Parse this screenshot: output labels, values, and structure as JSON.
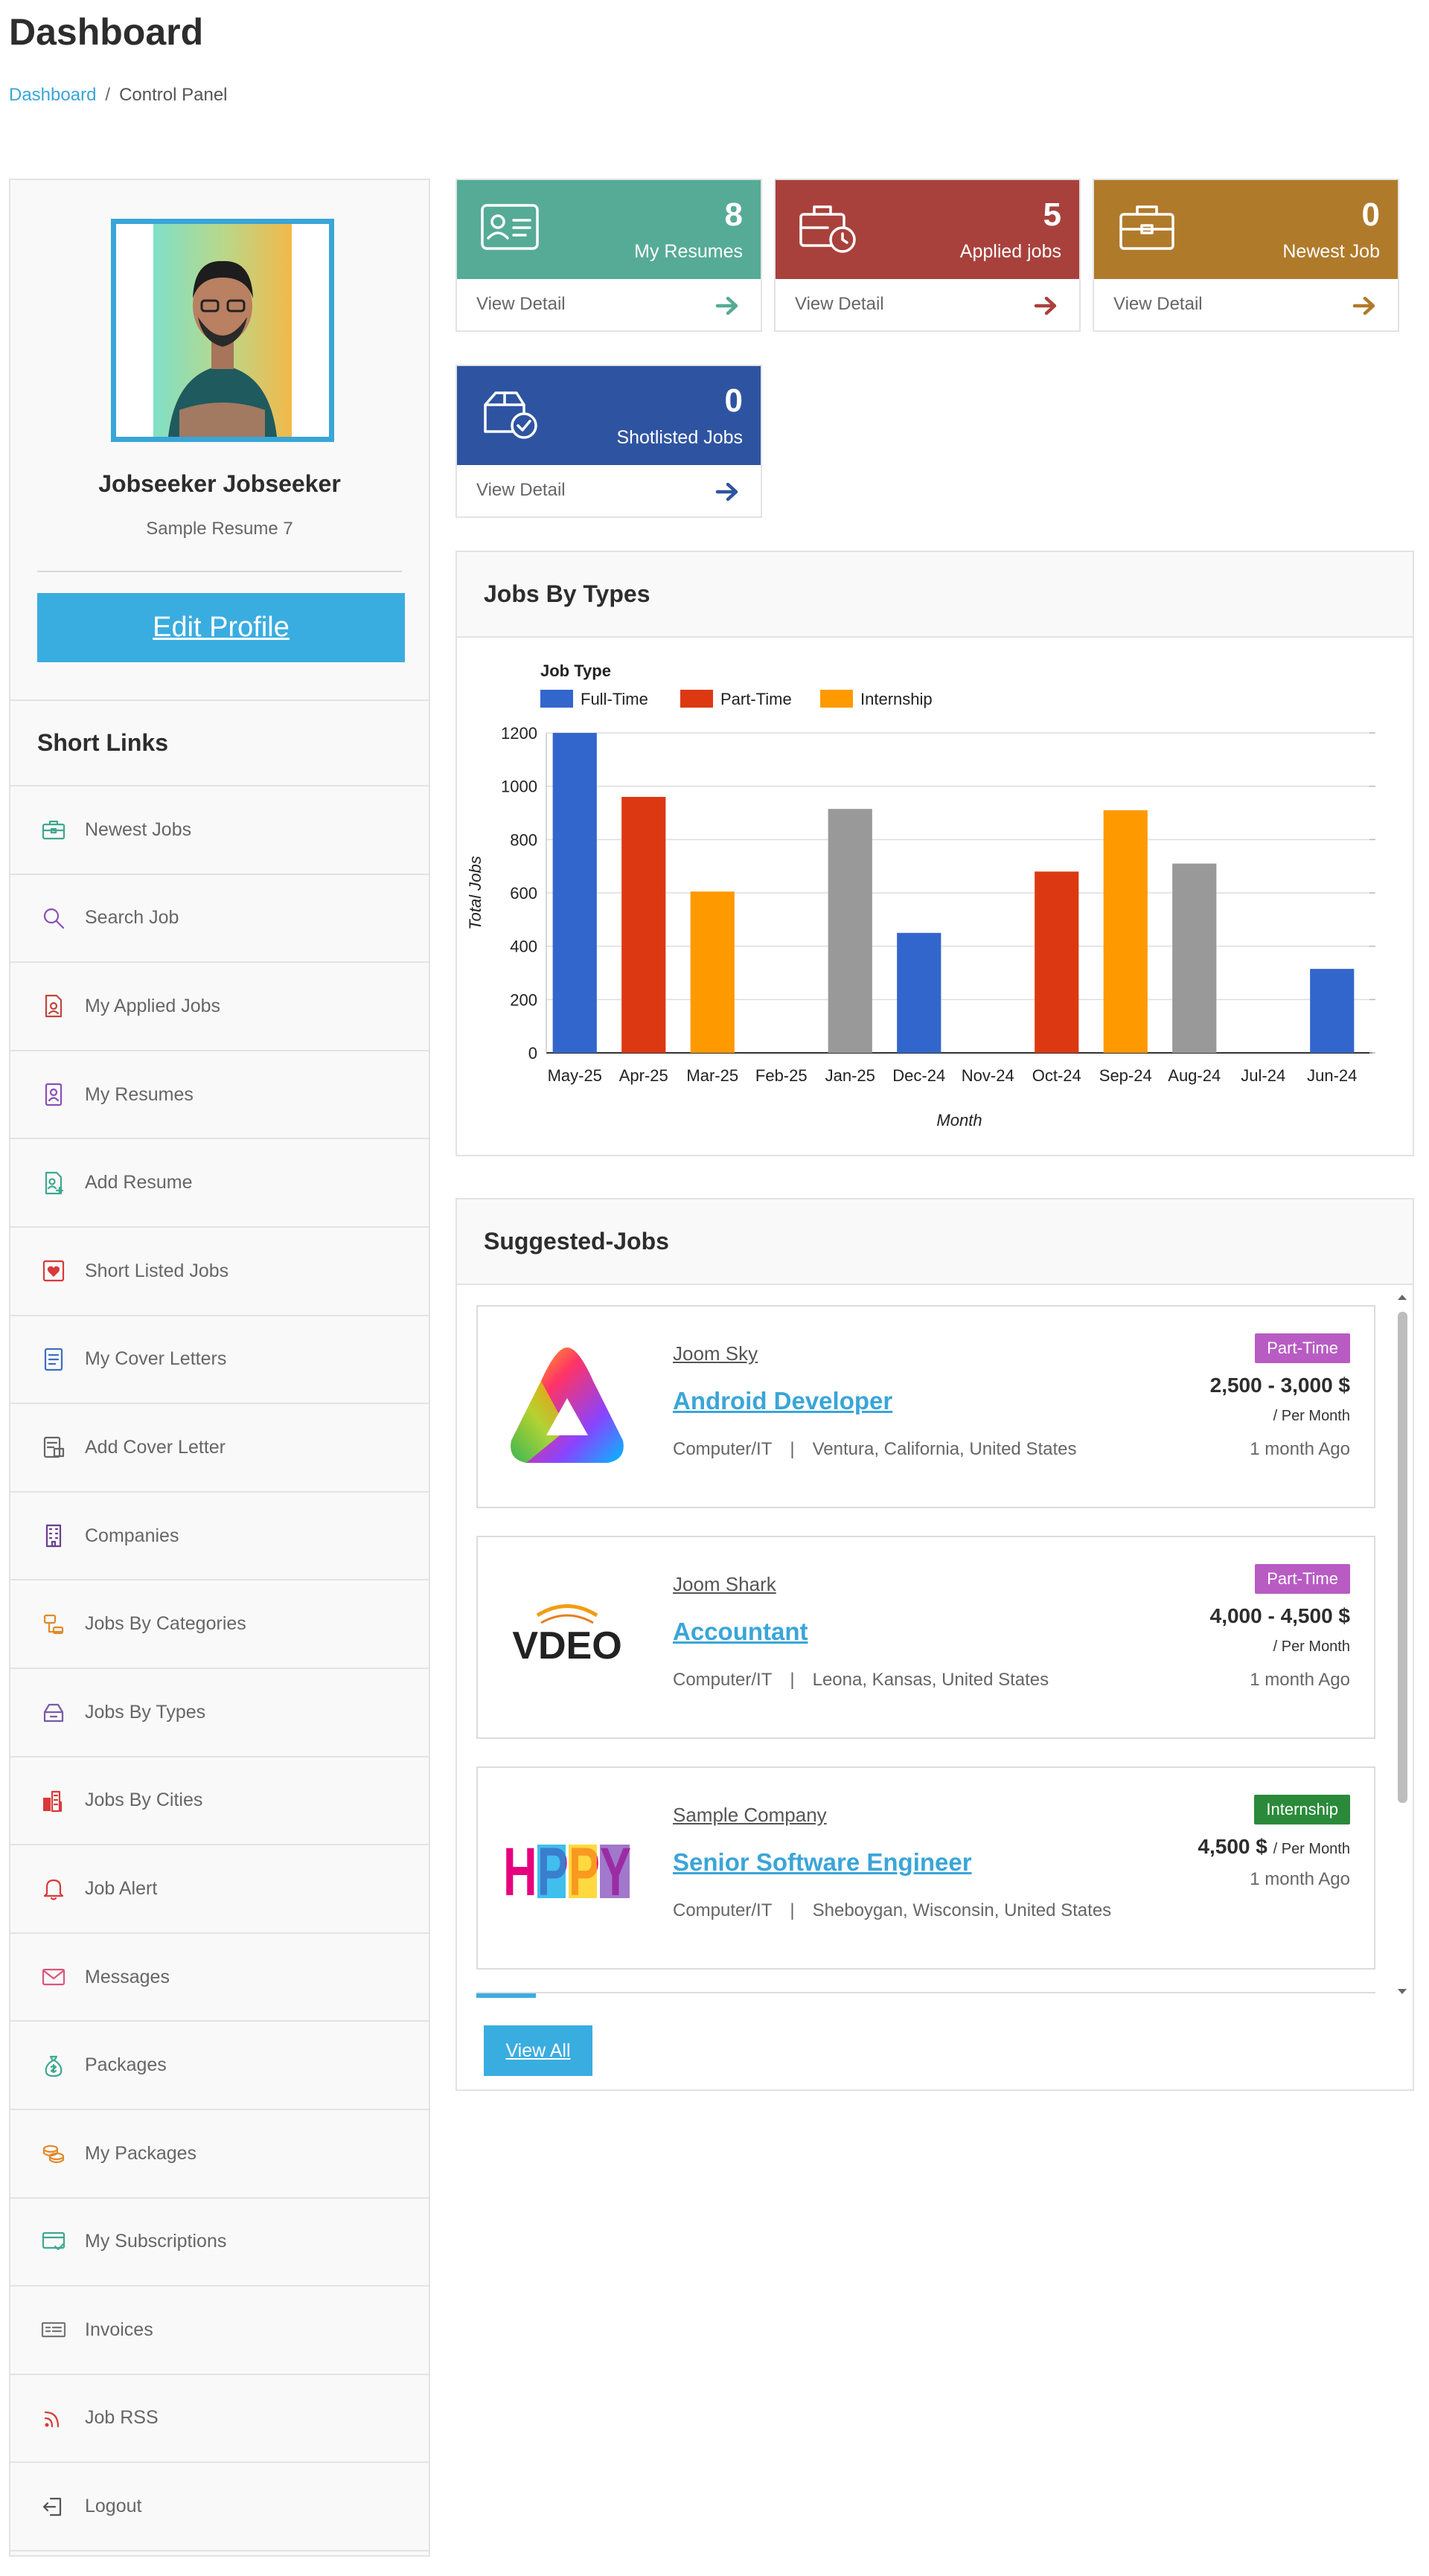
{
  "page": {
    "title": "Dashboard",
    "breadcrumb": {
      "link": "Dashboard",
      "current": "Control Panel"
    }
  },
  "profile": {
    "name": "Jobseeker Jobseeker",
    "subtitle": "Sample Resume 7",
    "edit_label": "Edit Profile"
  },
  "sidebar": {
    "title": "Short Links",
    "items": [
      {
        "label": "Newest Jobs",
        "icon": "briefcase-icon",
        "color": "#3fa88f"
      },
      {
        "label": "Search Job",
        "icon": "search-icon",
        "color": "#8a4fb5"
      },
      {
        "label": "My Applied Jobs",
        "icon": "applied-document-icon",
        "color": "#c0453b"
      },
      {
        "label": "My Resumes",
        "icon": "resume-icon",
        "color": "#8a4fb5"
      },
      {
        "label": "Add Resume",
        "icon": "add-resume-icon",
        "color": "#3fa88f"
      },
      {
        "label": "Short Listed Jobs",
        "icon": "heart-icon",
        "color": "#d9393a"
      },
      {
        "label": "My Cover Letters",
        "icon": "cover-letter-icon",
        "color": "#3a6fc4"
      },
      {
        "label": "Add Cover Letter",
        "icon": "add-cover-letter-icon",
        "color": "#666666"
      },
      {
        "label": "Companies",
        "icon": "building-icon",
        "color": "#6a3d91"
      },
      {
        "label": "Jobs By Categories",
        "icon": "categories-icon",
        "color": "#e08a2c"
      },
      {
        "label": "Jobs By Types",
        "icon": "types-icon",
        "color": "#7a5aa8"
      },
      {
        "label": "Jobs By Cities",
        "icon": "city-icon",
        "color": "#d9393a"
      },
      {
        "label": "Job Alert",
        "icon": "bell-icon",
        "color": "#d9393a"
      },
      {
        "label": "Messages",
        "icon": "envelope-icon",
        "color": "#d9577a"
      },
      {
        "label": "Packages",
        "icon": "money-bag-icon",
        "color": "#3fa88f"
      },
      {
        "label": "My Packages",
        "icon": "coins-icon",
        "color": "#e08a2c"
      },
      {
        "label": "My Subscriptions",
        "icon": "subscription-icon",
        "color": "#3fa88f"
      },
      {
        "label": "Invoices",
        "icon": "invoice-icon",
        "color": "#777777"
      },
      {
        "label": "Job RSS",
        "icon": "rss-icon",
        "color": "#d9393a"
      },
      {
        "label": "Logout",
        "icon": "logout-icon",
        "color": "#555555"
      }
    ]
  },
  "stats": [
    {
      "count": "8",
      "label": "My Resumes",
      "link": "View Detail",
      "color": "#56ab96",
      "icon": "resume-card-icon"
    },
    {
      "count": "5",
      "label": "Applied jobs",
      "link": "View Detail",
      "color": "#a8413c",
      "icon": "briefcase-clock-icon"
    },
    {
      "count": "0",
      "label": "Newest Job",
      "link": "View Detail",
      "color": "#b07a2b",
      "icon": "briefcase-icon"
    },
    {
      "count": "0",
      "label": "Shotlisted Jobs",
      "link": "View Detail",
      "color": "#2e54a1",
      "icon": "box-check-icon"
    }
  ],
  "chart_panel": {
    "title": "Jobs By Types"
  },
  "chart_data": {
    "type": "bar",
    "legend_title": "Job Type",
    "legend": [
      {
        "name": "Full-Time",
        "color": "#3366cc"
      },
      {
        "name": "Part-Time",
        "color": "#dc3912"
      },
      {
        "name": "Internship",
        "color": "#ff9900"
      }
    ],
    "categories": [
      "May-25",
      "Apr-25",
      "Mar-25",
      "Feb-25",
      "Jan-25",
      "Dec-24",
      "Nov-24",
      "Oct-24",
      "Sep-24",
      "Aug-24",
      "Jul-24",
      "Jun-24"
    ],
    "values": [
      1200,
      960,
      605,
      0,
      915,
      450,
      0,
      680,
      910,
      710,
      0,
      315
    ],
    "bar_colors": [
      "#3366cc",
      "#dc3912",
      "#ff9900",
      "#999999",
      "#999999",
      "#3366cc",
      "#dc3912",
      "#dc3912",
      "#ff9900",
      "#999999",
      "#999999",
      "#3366cc"
    ],
    "ylim": [
      0,
      1200
    ],
    "yticks": [
      0,
      200,
      400,
      600,
      800,
      1000,
      1200
    ],
    "xlabel": "Month",
    "ylabel": "Total Jobs",
    "legend_position": "top-left",
    "grid": true
  },
  "jobs_panel": {
    "title": "Suggested-Jobs",
    "view_all": "View All"
  },
  "jobs": [
    {
      "company": "Joom Sky",
      "title": "Android Developer",
      "category": "Computer/IT",
      "location": "Ventura, California, United States",
      "type": "Part-Time",
      "type_color": "#b85cc4",
      "salary": "2,500 - 3,000 $",
      "per": "/ Per Month",
      "ago": "1 month Ago",
      "logo": "triangle-logo"
    },
    {
      "company": "Joom Shark",
      "title": "Accountant",
      "category": "Computer/IT",
      "location": "Leona, Kansas, United States",
      "type": "Part-Time",
      "type_color": "#b85cc4",
      "salary": "4,000 - 4,500 $",
      "per": "/ Per Month",
      "ago": "1 month Ago",
      "logo": "video-logo",
      "logo_text": "VDEO"
    },
    {
      "company": "Sample Company",
      "title": "Senior Software Engineer",
      "category": "Computer/IT",
      "location": "Sheboygan, Wisconsin, United States",
      "type": "Internship",
      "type_color": "#2a8a3a",
      "salary": "4,500 $",
      "per": "/ Per Month",
      "ago": "1 month Ago",
      "logo": "happy-logo",
      "logo_text": "HPPY"
    }
  ]
}
